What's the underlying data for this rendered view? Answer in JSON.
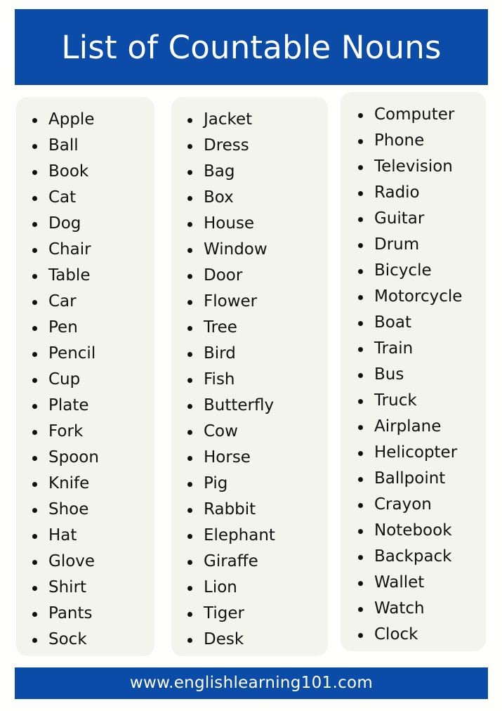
{
  "header": {
    "title": "List of Countable Nouns",
    "background_color": "#0b4ca8",
    "text_color": "#ffffff"
  },
  "footer": {
    "url": "www.englishlearning101.com",
    "background_color": "#0b4ca8",
    "text_color": "#ffffff"
  },
  "page": {
    "background_color": "#fefefd",
    "card_background_color": "#f4f4ef",
    "text_color": "#111111"
  },
  "columns": [
    {
      "id": "column-1",
      "items": [
        "Apple",
        "Ball",
        "Book",
        "Cat",
        "Dog",
        "Chair",
        "Table",
        "Car",
        "Pen",
        "Pencil",
        "Cup",
        "Plate",
        "Fork",
        "Spoon",
        "Knife",
        "Shoe",
        "Hat",
        "Glove",
        "Shirt",
        "Pants",
        "Sock"
      ]
    },
    {
      "id": "column-2",
      "items": [
        "Jacket",
        "Dress",
        "Bag",
        "Box",
        "House",
        "Window",
        "Door",
        "Flower",
        "Tree",
        "Bird",
        "Fish",
        "Butterfly",
        "Cow",
        "Horse",
        "Pig",
        "Rabbit",
        "Elephant",
        "Giraffe",
        "Lion",
        "Tiger",
        "Desk"
      ]
    },
    {
      "id": "column-3",
      "items": [
        "Computer",
        "Phone",
        "Television",
        "Radio",
        "Guitar",
        "Drum",
        "Bicycle",
        "Motorcycle",
        "Boat",
        "Train",
        "Bus",
        "Truck",
        "Airplane",
        "Helicopter",
        "Ballpoint",
        "Crayon",
        "Notebook",
        "Backpack",
        "Wallet",
        "Watch",
        "Clock"
      ]
    }
  ]
}
